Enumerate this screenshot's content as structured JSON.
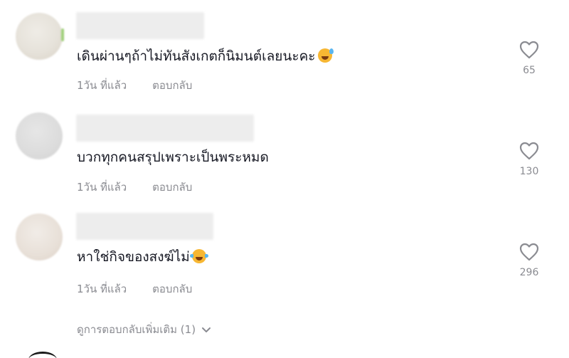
{
  "comments": [
    {
      "text": "เดินผ่านๆถ้าไม่ทันสังเกตก็นิมนต์เลยนะคะ",
      "emoji": "sweat-smile-emoji",
      "time": "1วัน ที่แล้ว",
      "reply_label": "ตอบกลับ",
      "like_count": "65"
    },
    {
      "text": "บวกทุกคนสรุปเพราะเป็นพระหมด",
      "time": "1วัน ที่แล้ว",
      "reply_label": "ตอบกลับ",
      "like_count": "130"
    },
    {
      "text": "หาใช่กิจของสงฆ์ไม่",
      "emoji": "tears-of-joy-emoji",
      "time": "1วัน ที่แล้ว",
      "reply_label": "ตอบกลับ",
      "like_count": "296"
    }
  ],
  "view_more_replies": "ดูการตอบกลับเพิ่มเติม (1)",
  "icons": {
    "like": "heart-outline-icon",
    "expand": "chevron-down-icon"
  },
  "colors": {
    "text": "#161823",
    "meta": "#8a8b91",
    "background": "#ffffff"
  }
}
